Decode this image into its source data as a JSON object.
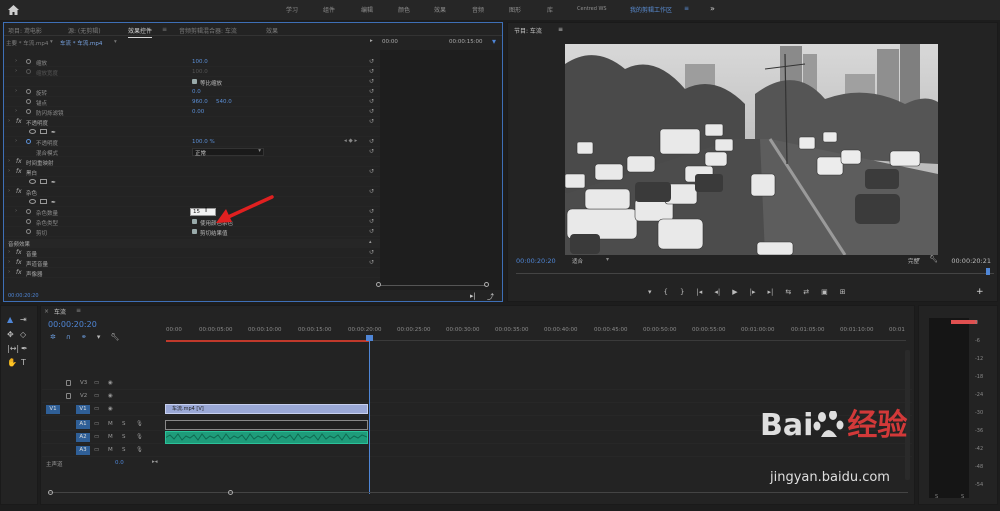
{
  "topbar": {
    "tabs": [
      "学习",
      "组件",
      "编辑",
      "颜色",
      "效果",
      "音频",
      "图形",
      "库",
      "Centred WS",
      "我的剪辑工作区"
    ],
    "active_tab": "我的剪辑工作区",
    "more": "»"
  },
  "effects_panel": {
    "tabs": [
      "项目: 鸢电影",
      "源: (无剪辑)",
      "效果控件",
      "≡",
      "音频剪辑混合器: 车流",
      "效果"
    ],
    "active_tab": "效果控件",
    "clip_path_main": "主要 * 车流.mp4",
    "clip_path_seq": "车流 * 车流.mp4",
    "mini_times": [
      "00:00",
      "00:00:15:00"
    ],
    "rows": {
      "scale": {
        "label": "缩放",
        "value": "100.0"
      },
      "scale_width": {
        "label": "缩放宽度",
        "value": "100.0"
      },
      "uniform_scale": "等比缩放",
      "rotation": {
        "label": "旋转",
        "value": "0.0"
      },
      "anchor": {
        "label": "锚点",
        "value_x": "960.0",
        "value_y": "540.0"
      },
      "anti_flicker": {
        "label": "防闪烁滤镜",
        "value": "0.00"
      },
      "opacity_section": "不透明度",
      "opacity": {
        "label": "不透明度",
        "value": "100.0 %"
      },
      "blend_mode": {
        "label": "混合模式",
        "value": "正常"
      },
      "time_remap": "时间重映射",
      "black_white": "黑白",
      "noise_section": "杂色",
      "noise_amount": {
        "label": "杂色数量",
        "value": "15"
      },
      "noise_type": {
        "label": "杂色类型",
        "check": "使用颜色杂色"
      },
      "clipping": {
        "label": "剪切",
        "check": "剪切结果值"
      },
      "audio_effects": "音频效果",
      "volume": "音量",
      "channel_volume": "声道音量",
      "panner": "声像器"
    },
    "footer_time": "00:00:20:20"
  },
  "program_monitor": {
    "title": "节目: 车流",
    "menu": "≡",
    "timecode_left": "00:00:20:20",
    "fit": "适合",
    "quality": "完整",
    "timecode_right": "00:00:20:21",
    "transport": [
      "▾",
      "{",
      "}",
      "|◂",
      "◂|",
      "▶",
      "|▸",
      "▸|",
      "⇆",
      "⇄",
      "▣",
      "⊞",
      "+"
    ]
  },
  "timeline": {
    "title": "车流",
    "menu": "≡",
    "timecode": "00:00:20:20",
    "ruler": [
      "00:00",
      "00:00:05:00",
      "00:00:10:00",
      "00:00:15:00",
      "00:00:20:00",
      "00:00:25:00",
      "00:00:30:00",
      "00:00:35:00",
      "00:00:40:00",
      "00:00:45:00",
      "00:00:50:00",
      "00:00:55:00",
      "00:01:00:00",
      "00:01:05:00",
      "00:01:10:00",
      "00:01"
    ],
    "tracks": [
      "V3",
      "V2",
      "V1",
      "A1",
      "A2",
      "A3"
    ],
    "source_v": "V1",
    "clip_video": "车流.mp4 [V]",
    "master": {
      "label": "主声道",
      "value": "0.0"
    },
    "track_toggles": [
      "M",
      "S"
    ]
  },
  "meters": {
    "scale": [
      "0",
      "-6",
      "-12",
      "-18",
      "-24",
      "-30",
      "-36",
      "-42",
      "-48",
      "-54"
    ],
    "bottom": [
      "S",
      "S"
    ]
  },
  "watermark": {
    "text_a": "Bai",
    "text_b": "经验",
    "url": "jingyan.baidu.com"
  }
}
